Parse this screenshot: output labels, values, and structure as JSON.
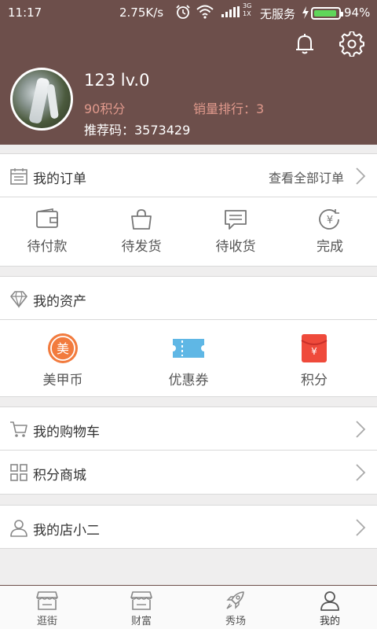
{
  "status_bar": {
    "time": "11:17",
    "net_speed": "2.75K/s",
    "net_type_top": "3G",
    "net_type_bottom": "1X",
    "carrier": "无服务",
    "battery": "94%",
    "battery_level": 0.94,
    "battery_color": "#5fd65a"
  },
  "header": {
    "background": "#6d4f4b",
    "username": "123  lv.0",
    "points": "90积分",
    "sales_rank": "销量排行：3",
    "referral_code": "推荐码：3573429"
  },
  "orders": {
    "title": "我的订单",
    "view_all": "查看全部订单",
    "items": [
      {
        "label": "待付款",
        "icon": "wallet-icon"
      },
      {
        "label": "待发货",
        "icon": "shopping-bag-icon"
      },
      {
        "label": "待收货",
        "icon": "chat-bubble-icon"
      },
      {
        "label": "完成",
        "icon": "yen-refresh-icon"
      }
    ]
  },
  "assets": {
    "title": "我的资产",
    "items": [
      {
        "label": "美甲币",
        "icon": "coin-icon",
        "icon_text": "美",
        "color": "#f27b3e"
      },
      {
        "label": "优惠券",
        "icon": "coupon-icon",
        "color": "#5fb7e5"
      },
      {
        "label": "积分",
        "icon": "red-envelope-icon",
        "icon_text": "¥",
        "color": "#ef4a3b"
      }
    ]
  },
  "menu": {
    "cart": "我的购物车",
    "points_mall": "积分商城",
    "shop_assistant": "我的店小二"
  },
  "tabbar": {
    "accent": "#6d4f4b",
    "tabs": [
      {
        "label": "逛街",
        "icon": "storefront-icon"
      },
      {
        "label": "财富",
        "icon": "storefront-icon"
      },
      {
        "label": "秀场",
        "icon": "rocket-icon"
      },
      {
        "label": "我的",
        "icon": "person-icon",
        "active": true
      }
    ]
  }
}
